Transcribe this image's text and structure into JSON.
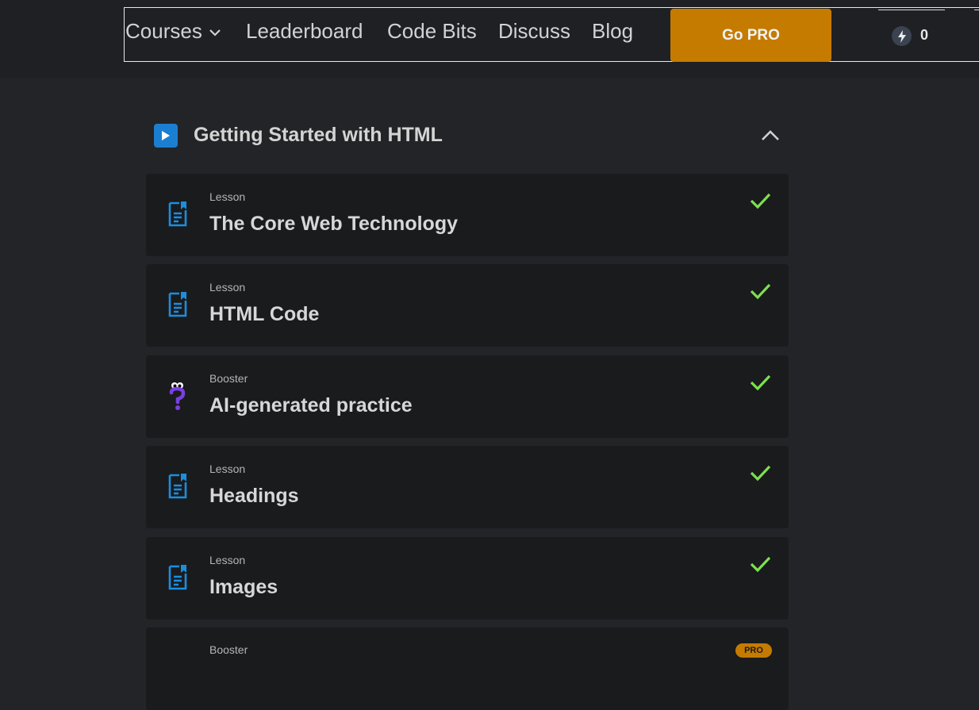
{
  "nav": {
    "items": [
      "Courses",
      "Leaderboard",
      "Code Bits",
      "Discuss",
      "Blog"
    ],
    "go_pro": "Go PRO",
    "xp_count": "0"
  },
  "module": {
    "title": "Getting Started with HTML"
  },
  "cards": [
    {
      "kind": "Lesson",
      "title": "The Core Web Technology",
      "icon": "lesson-doc-icon",
      "status": "completed"
    },
    {
      "kind": "Lesson",
      "title": "HTML Code",
      "icon": "lesson-doc-icon",
      "status": "completed"
    },
    {
      "kind": "Booster",
      "title": "AI-generated practice",
      "icon": "question-mark-icon",
      "status": "completed"
    },
    {
      "kind": "Lesson",
      "title": "Headings",
      "icon": "lesson-doc-icon",
      "status": "completed"
    },
    {
      "kind": "Lesson",
      "title": "Images",
      "icon": "lesson-doc-icon",
      "status": "completed"
    },
    {
      "kind": "Booster",
      "title": "",
      "icon": "question-mark-icon",
      "status": "pro",
      "badge": "PRO"
    }
  ],
  "colors": {
    "accent": "#c57b00",
    "check": "#7ee04f",
    "lesson_icon": "#1b8ee0",
    "booster_icon": "#7b3fe0"
  }
}
